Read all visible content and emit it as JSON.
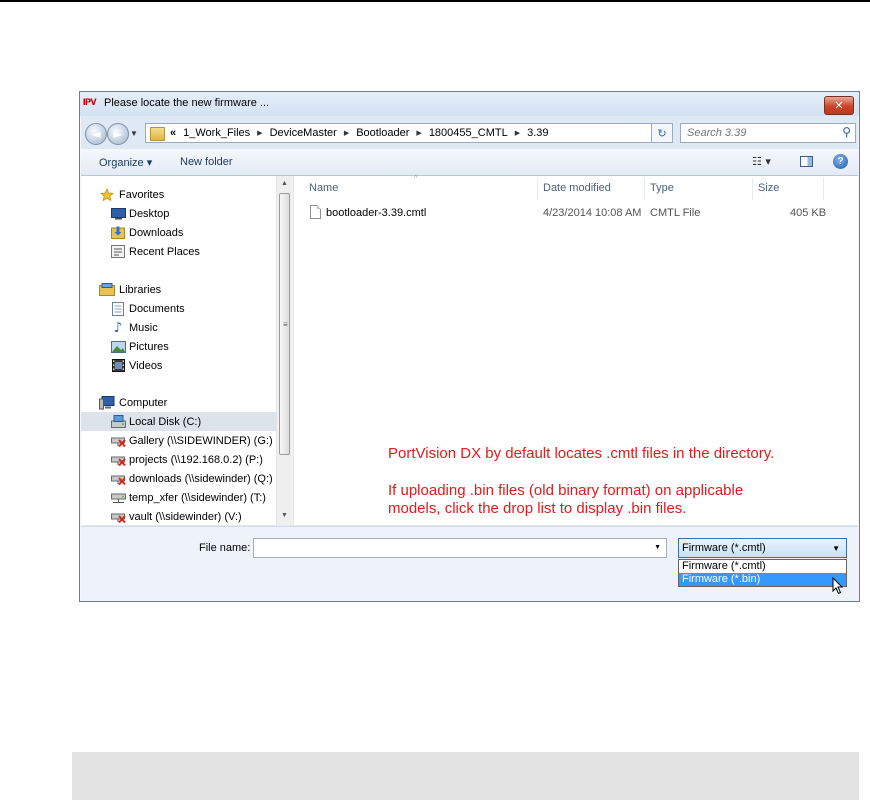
{
  "window": {
    "title": "Please locate the new firmware ...",
    "app_icon_text": "IPV",
    "close_glyph": "✕"
  },
  "navigation": {
    "back_glyph": "◄",
    "forward_glyph": "►",
    "breadcrumb_lead": "«",
    "breadcrumbs": [
      "1_Work_Files",
      "DeviceMaster",
      "Bootloader",
      "1800455_CMTL",
      "3.39"
    ],
    "search_placeholder": "Search 3.39"
  },
  "toolbar": {
    "organize_label": "Organize ▾",
    "new_folder_label": "New folder",
    "view_glyph": "☷ ▾",
    "help_glyph": "?"
  },
  "sidebar": {
    "groups": [
      {
        "label": "Favorites",
        "icon": "star-icon",
        "children": [
          {
            "label": "Desktop",
            "icon": "desktop-icon"
          },
          {
            "label": "Downloads",
            "icon": "downloads-folder-icon"
          },
          {
            "label": "Recent Places",
            "icon": "recent-places-icon"
          }
        ]
      },
      {
        "label": "Libraries",
        "icon": "libraries-icon",
        "children": [
          {
            "label": "Documents",
            "icon": "documents-icon"
          },
          {
            "label": "Music",
            "icon": "music-icon"
          },
          {
            "label": "Pictures",
            "icon": "pictures-icon"
          },
          {
            "label": "Videos",
            "icon": "videos-icon"
          }
        ]
      },
      {
        "label": "Computer",
        "icon": "computer-icon",
        "children": [
          {
            "label": "Local Disk (C:)",
            "icon": "local-disk-icon",
            "selected": true
          },
          {
            "label": "Gallery (\\\\SIDEWINDER) (G:)",
            "icon": "disconnected-drive-icon"
          },
          {
            "label": "projects (\\\\192.168.0.2) (P:)",
            "icon": "disconnected-drive-icon"
          },
          {
            "label": "downloads (\\\\sidewinder) (Q:)",
            "icon": "disconnected-drive-icon"
          },
          {
            "label": "temp_xfer (\\\\sidewinder) (T:)",
            "icon": "network-drive-icon"
          },
          {
            "label": "vault (\\\\sidewinder) (V:)",
            "icon": "disconnected-drive-icon"
          }
        ]
      }
    ]
  },
  "file_list": {
    "columns": [
      "Name",
      "Date modified",
      "Type",
      "Size"
    ],
    "rows": [
      {
        "name": "bootloader-3.39.cmtl",
        "date": "4/23/2014 10:08 AM",
        "type": "CMTL File",
        "size": "405 KB"
      }
    ]
  },
  "annotation": {
    "line1": "PortVision DX by default locates .cmtl files in the directory.",
    "line2": "If uploading .bin files (old binary format) on applicable",
    "line3": "models, click the drop list to display .bin files.",
    "color": "#e11b1b"
  },
  "footer": {
    "file_name_label": "File name:",
    "file_name_value": "",
    "filter_selected": "Firmware (*.cmtl)",
    "filter_options": [
      "Firmware (*.cmtl)",
      "Firmware (*.bin)"
    ],
    "filter_highlighted_index": 1
  }
}
